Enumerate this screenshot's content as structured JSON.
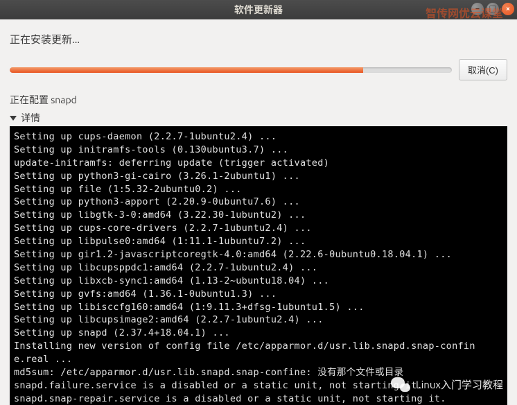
{
  "window": {
    "title": "软件更新器"
  },
  "watermark_top": "智传网优云课堂",
  "heading": "正在安装更新...",
  "cancel_label": "取消(C)",
  "config_text": "正在配置 snapd",
  "details_label": "详情",
  "progress_percent": 80,
  "terminal_lines": [
    "Setting up cups-daemon (2.2.7-1ubuntu2.4) ...",
    "Setting up initramfs-tools (0.130ubuntu3.7) ...",
    "update-initramfs: deferring update (trigger activated)",
    "Setting up python3-gi-cairo (3.26.1-2ubuntu1) ...",
    "Setting up file (1:5.32-2ubuntu0.2) ...",
    "Setting up python3-apport (2.20.9-0ubuntu7.6) ...",
    "Setting up libgtk-3-0:amd64 (3.22.30-1ubuntu2) ...",
    "Setting up cups-core-drivers (2.2.7-1ubuntu2.4) ...",
    "Setting up libpulse0:amd64 (1:11.1-1ubuntu7.2) ...",
    "Setting up gir1.2-javascriptcoregtk-4.0:amd64 (2.22.6-0ubuntu0.18.04.1) ...",
    "Setting up libcupsppdc1:amd64 (2.2.7-1ubuntu2.4) ...",
    "Setting up libxcb-sync1:amd64 (1.13-2~ubuntu18.04) ...",
    "Setting up gvfs:amd64 (1.36.1-0ubuntu1.3) ...",
    "Setting up libisccfg160:amd64 (1:9.11.3+dfsg-1ubuntu1.5) ...",
    "Setting up libcupsimage2:amd64 (2.2.7-1ubuntu2.4) ...",
    "Setting up snapd (2.37.4+18.04.1) ...",
    "Installing new version of config file /etc/apparmor.d/usr.lib.snapd.snap-confin",
    "e.real ...",
    "md5sum: /etc/apparmor.d/usr.lib.snapd.snap-confine: 没有那个文件或目录",
    "snapd.failure.service is a disabled or a static unit, not starting it.",
    "snapd.snap-repair.service is a disabled or a static unit, not starting it."
  ],
  "wechat_text": "Linux入门学习教程"
}
